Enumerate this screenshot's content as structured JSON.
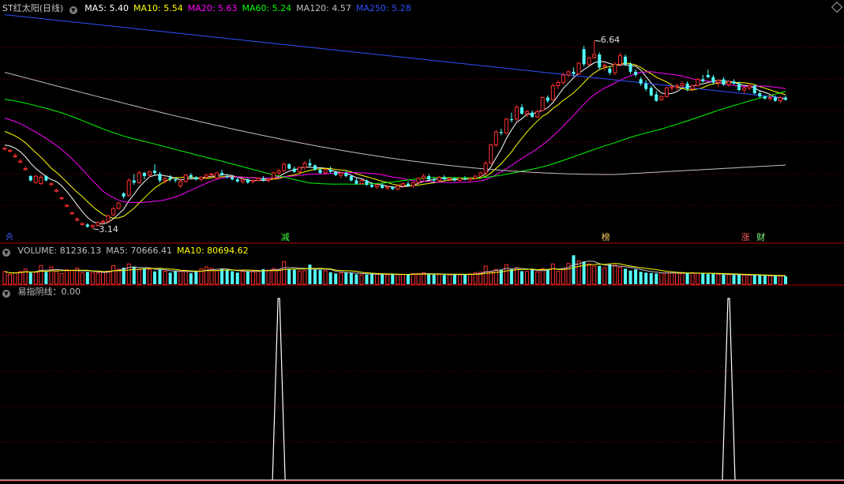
{
  "header": {
    "stock_name": "ST红太阳(日线)",
    "ma_items": [
      {
        "label": "MA5: 5.40",
        "color": "#ffffff"
      },
      {
        "label": "MA10: 5.54",
        "color": "#ffff00"
      },
      {
        "label": "MA20: 5.63",
        "color": "#ff00ff"
      },
      {
        "label": "MA60: 5.24",
        "color": "#00ff00"
      },
      {
        "label": "MA120: 4.57",
        "color": "#c0c0c0"
      },
      {
        "label": "MA250: 5.28",
        "color": "#3050ff"
      }
    ]
  },
  "volume_header": {
    "items": [
      {
        "label": "VOLUME: 81236.13",
        "color": "#c0c0c0"
      },
      {
        "label": "MA5: 70666.41",
        "color": "#c0c0c0"
      },
      {
        "label": "MA10: 80694.62",
        "color": "#ffff00"
      }
    ]
  },
  "indicator_header": {
    "label": "易指阴线：0.00"
  },
  "colors": {
    "up": "#ff3030",
    "down": "#54ffff",
    "grid": "#800000",
    "axis": "#b00000"
  },
  "chart_data": [
    {
      "type": "candlestick",
      "name": "price",
      "low_annotation": "3.14",
      "high_annotation": "6.64",
      "signal_tags": [
        {
          "index": 54,
          "text": "减",
          "color": "#40ff40"
        },
        {
          "index": 116,
          "text": "榜",
          "color": "#ffcc66"
        },
        {
          "index": 143,
          "text": "涨",
          "color": "#ff6060"
        },
        {
          "index": 146,
          "text": "财",
          "color": "#80ff80"
        }
      ],
      "ohlc": [
        [
          4.62,
          4.66,
          4.6,
          4.64
        ],
        [
          4.58,
          4.62,
          4.56,
          4.6
        ],
        [
          4.48,
          4.54,
          4.46,
          4.5
        ],
        [
          4.38,
          4.44,
          4.36,
          4.4
        ],
        [
          4.24,
          4.3,
          4.22,
          4.26
        ],
        [
          4.12,
          4.14,
          4.02,
          4.04
        ],
        [
          4.0,
          4.14,
          3.98,
          4.12
        ],
        [
          3.98,
          4.14,
          3.96,
          4.1
        ],
        [
          4.12,
          4.14,
          4.02,
          4.04
        ],
        [
          3.96,
          4.0,
          3.94,
          3.98
        ],
        [
          3.84,
          3.88,
          3.82,
          3.86
        ],
        [
          3.7,
          3.74,
          3.68,
          3.72
        ],
        [
          3.56,
          3.6,
          3.54,
          3.58
        ],
        [
          3.42,
          3.46,
          3.4,
          3.44
        ],
        [
          3.3,
          3.36,
          3.28,
          3.32
        ],
        [
          3.22,
          3.26,
          3.2,
          3.24
        ],
        [
          3.22,
          3.24,
          3.16,
          3.18
        ],
        [
          3.18,
          3.22,
          3.14,
          3.2
        ],
        [
          3.2,
          3.28,
          3.18,
          3.26
        ],
        [
          3.26,
          3.32,
          3.22,
          3.28
        ],
        [
          3.28,
          3.4,
          3.26,
          3.38
        ],
        [
          3.4,
          3.54,
          3.38,
          3.52
        ],
        [
          3.52,
          3.64,
          3.5,
          3.62
        ],
        [
          3.8,
          3.82,
          3.7,
          3.74
        ],
        [
          3.76,
          4.08,
          3.74,
          4.04
        ],
        [
          4.04,
          4.16,
          3.96,
          4.0
        ],
        [
          4.0,
          4.22,
          3.98,
          4.18
        ],
        [
          4.18,
          4.2,
          4.06,
          4.12
        ],
        [
          4.14,
          4.22,
          4.1,
          4.2
        ],
        [
          4.22,
          4.34,
          4.14,
          4.18
        ],
        [
          4.16,
          4.2,
          4.0,
          4.04
        ],
        [
          4.04,
          4.1,
          3.98,
          4.08
        ],
        [
          4.1,
          4.14,
          4.02,
          4.06
        ],
        [
          4.06,
          4.1,
          4.0,
          4.04
        ],
        [
          3.94,
          4.06,
          3.9,
          4.02
        ],
        [
          4.02,
          4.16,
          4.0,
          4.14
        ],
        [
          4.14,
          4.18,
          4.06,
          4.1
        ],
        [
          4.1,
          4.12,
          4.04,
          4.06
        ],
        [
          4.06,
          4.12,
          4.02,
          4.1
        ],
        [
          4.1,
          4.16,
          4.06,
          4.14
        ],
        [
          4.14,
          4.18,
          4.1,
          4.16
        ],
        [
          4.08,
          4.2,
          4.06,
          4.18
        ],
        [
          4.18,
          4.24,
          4.12,
          4.14
        ],
        [
          4.12,
          4.16,
          4.08,
          4.1
        ],
        [
          4.1,
          4.14,
          4.04,
          4.06
        ],
        [
          4.06,
          4.1,
          4.0,
          4.02
        ],
        [
          4.02,
          4.08,
          3.98,
          4.06
        ],
        [
          4.06,
          4.08,
          3.98,
          4.0
        ],
        [
          4.02,
          4.06,
          3.98,
          4.04
        ],
        [
          4.04,
          4.1,
          4.02,
          4.08
        ],
        [
          4.08,
          4.12,
          4.02,
          4.04
        ],
        [
          4.04,
          4.08,
          4.0,
          4.06
        ],
        [
          4.08,
          4.2,
          4.06,
          4.18
        ],
        [
          4.18,
          4.26,
          4.14,
          4.22
        ],
        [
          4.22,
          4.38,
          4.2,
          4.34
        ],
        [
          4.34,
          4.36,
          4.24,
          4.26
        ],
        [
          4.26,
          4.3,
          4.18,
          4.2
        ],
        [
          4.2,
          4.3,
          4.18,
          4.28
        ],
        [
          4.28,
          4.4,
          4.24,
          4.36
        ],
        [
          4.36,
          4.44,
          4.28,
          4.32
        ],
        [
          4.32,
          4.34,
          4.22,
          4.24
        ],
        [
          4.24,
          4.26,
          4.16,
          4.18
        ],
        [
          4.18,
          4.26,
          4.14,
          4.24
        ],
        [
          4.24,
          4.3,
          4.18,
          4.2
        ],
        [
          4.2,
          4.22,
          4.12,
          4.14
        ],
        [
          4.14,
          4.2,
          4.08,
          4.18
        ],
        [
          4.18,
          4.22,
          4.1,
          4.12
        ],
        [
          4.12,
          4.14,
          4.02,
          4.04
        ],
        [
          4.04,
          4.08,
          3.96,
          3.98
        ],
        [
          3.98,
          4.06,
          3.96,
          4.04
        ],
        [
          4.04,
          4.06,
          3.94,
          3.96
        ],
        [
          3.96,
          4.0,
          3.9,
          3.92
        ],
        [
          3.92,
          3.98,
          3.88,
          3.96
        ],
        [
          3.96,
          4.0,
          3.88,
          3.9
        ],
        [
          3.9,
          3.94,
          3.86,
          3.92
        ],
        [
          3.92,
          3.94,
          3.86,
          3.88
        ],
        [
          3.88,
          3.96,
          3.86,
          3.94
        ],
        [
          3.94,
          4.0,
          3.9,
          3.98
        ],
        [
          3.98,
          4.02,
          3.92,
          3.94
        ],
        [
          3.94,
          4.02,
          3.9,
          4.0
        ],
        [
          4.0,
          4.1,
          3.98,
          4.08
        ],
        [
          4.08,
          4.16,
          4.04,
          4.12
        ],
        [
          4.12,
          4.16,
          4.04,
          4.06
        ],
        [
          4.06,
          4.1,
          4.0,
          4.04
        ],
        [
          4.04,
          4.12,
          4.02,
          4.1
        ],
        [
          4.1,
          4.14,
          4.04,
          4.06
        ],
        [
          4.06,
          4.1,
          4.02,
          4.08
        ],
        [
          4.08,
          4.1,
          4.02,
          4.04
        ],
        [
          4.04,
          4.1,
          4.02,
          4.08
        ],
        [
          4.08,
          4.12,
          4.04,
          4.06
        ],
        [
          4.06,
          4.1,
          4.02,
          4.08
        ],
        [
          4.08,
          4.14,
          4.06,
          4.12
        ],
        [
          4.12,
          4.2,
          4.1,
          4.18
        ],
        [
          4.18,
          4.4,
          4.16,
          4.36
        ],
        [
          4.36,
          4.72,
          4.34,
          4.7
        ],
        [
          4.7,
          4.98,
          4.66,
          4.94
        ],
        [
          4.94,
          5.0,
          4.88,
          4.92
        ],
        [
          4.92,
          5.2,
          4.9,
          5.18
        ],
        [
          5.18,
          5.3,
          5.12,
          5.16
        ],
        [
          5.18,
          5.44,
          5.14,
          5.4
        ],
        [
          5.4,
          5.46,
          5.26,
          5.28
        ],
        [
          5.28,
          5.34,
          5.22,
          5.32
        ],
        [
          5.3,
          5.34,
          5.2,
          5.22
        ],
        [
          5.22,
          5.36,
          5.2,
          5.32
        ],
        [
          5.34,
          5.6,
          5.32,
          5.58
        ],
        [
          5.58,
          5.62,
          5.48,
          5.52
        ],
        [
          5.54,
          5.84,
          5.52,
          5.8
        ],
        [
          5.8,
          5.9,
          5.74,
          5.86
        ],
        [
          5.86,
          6.04,
          5.82,
          6.0
        ],
        [
          6.0,
          6.08,
          5.96,
          6.06
        ],
        [
          6.06,
          6.14,
          5.98,
          6.02
        ],
        [
          6.02,
          6.24,
          6.0,
          6.22
        ],
        [
          6.48,
          6.54,
          6.16,
          6.2
        ],
        [
          6.2,
          6.34,
          6.18,
          6.32
        ],
        [
          6.32,
          6.64,
          6.3,
          6.38
        ],
        [
          6.38,
          6.42,
          6.1,
          6.14
        ],
        [
          6.16,
          6.22,
          6.08,
          6.18
        ],
        [
          6.12,
          6.16,
          6.0,
          6.04
        ],
        [
          6.04,
          6.24,
          6.0,
          6.2
        ],
        [
          6.2,
          6.42,
          6.16,
          6.36
        ],
        [
          6.34,
          6.38,
          6.16,
          6.2
        ],
        [
          6.2,
          6.24,
          6.02,
          6.06
        ],
        [
          6.06,
          6.1,
          5.96,
          6.0
        ],
        [
          5.92,
          5.96,
          5.8,
          5.84
        ],
        [
          5.84,
          5.9,
          5.7,
          5.74
        ],
        [
          5.76,
          5.8,
          5.6,
          5.62
        ],
        [
          5.64,
          5.7,
          5.5,
          5.52
        ],
        [
          5.54,
          5.62,
          5.52,
          5.6
        ],
        [
          5.6,
          5.78,
          5.58,
          5.76
        ],
        [
          5.76,
          5.82,
          5.7,
          5.78
        ],
        [
          5.78,
          5.84,
          5.72,
          5.8
        ],
        [
          5.8,
          5.88,
          5.76,
          5.84
        ],
        [
          5.84,
          5.88,
          5.7,
          5.74
        ],
        [
          5.74,
          5.82,
          5.7,
          5.8
        ],
        [
          5.8,
          5.94,
          5.78,
          5.92
        ],
        [
          5.92,
          6.0,
          5.86,
          5.88
        ],
        [
          6.0,
          6.1,
          5.94,
          5.96
        ],
        [
          5.96,
          6.0,
          5.82,
          5.86
        ],
        [
          5.86,
          5.92,
          5.78,
          5.9
        ],
        [
          5.92,
          5.96,
          5.8,
          5.82
        ],
        [
          5.82,
          5.9,
          5.78,
          5.88
        ],
        [
          5.88,
          5.92,
          5.82,
          5.84
        ],
        [
          5.84,
          5.88,
          5.7,
          5.72
        ],
        [
          5.72,
          5.78,
          5.66,
          5.76
        ],
        [
          5.76,
          5.84,
          5.72,
          5.8
        ],
        [
          5.8,
          5.82,
          5.64,
          5.66
        ],
        [
          5.66,
          5.7,
          5.58,
          5.6
        ],
        [
          5.6,
          5.62,
          5.54,
          5.56
        ],
        [
          5.56,
          5.64,
          5.52,
          5.58
        ],
        [
          5.58,
          5.62,
          5.5,
          5.52
        ],
        [
          5.52,
          5.6,
          5.48,
          5.58
        ],
        [
          5.58,
          5.62,
          5.52,
          5.54
        ]
      ]
    },
    {
      "type": "bar",
      "name": "VOLUME",
      "values": [
        62000,
        48000,
        55000,
        61000,
        73000,
        56000,
        58000,
        90000,
        60000,
        84000,
        63000,
        52000,
        70000,
        66000,
        78000,
        55000,
        60000,
        55000,
        54000,
        61000,
        63000,
        90000,
        72000,
        80000,
        98000,
        82000,
        70000,
        76000,
        72000,
        62000,
        74000,
        63000,
        56000,
        63000,
        62000,
        67000,
        53000,
        60000,
        74000,
        84000,
        77000,
        65000,
        73000,
        70000,
        63000,
        56000,
        62000,
        61000,
        64000,
        66000,
        73000,
        68000,
        76000,
        72000,
        110000,
        74000,
        70000,
        64000,
        66000,
        95000,
        70000,
        69000,
        66000,
        58000,
        52000,
        54000,
        57000,
        56000,
        48000,
        45000,
        47000,
        52000,
        49000,
        47000,
        46000,
        48000,
        47000,
        48000,
        49000,
        51000,
        52000,
        56000,
        47000,
        46000,
        48000,
        45000,
        46000,
        47000,
        46000,
        48000,
        50000,
        56000,
        58000,
        88000,
        60000,
        72000,
        70000,
        95000,
        72000,
        80000,
        63000,
        62000,
        70000,
        60000,
        75000,
        72000,
        98000,
        62000,
        75000,
        100000,
        140000,
        112000,
        110000,
        98000,
        88000,
        89000,
        80000,
        96000,
        92000,
        82000,
        75000,
        66000,
        72000,
        60000,
        56000,
        54000,
        52000,
        55000,
        55000,
        54000,
        53000,
        52000,
        54000,
        56000,
        53000,
        52000,
        50000,
        50000,
        48000,
        47000,
        46000,
        45000,
        46000,
        45000,
        44000,
        43000,
        42000,
        41000,
        40000,
        40000,
        39000,
        38000
      ]
    },
    {
      "type": "line",
      "name": "易指阴线",
      "spikes": [
        {
          "index": 53,
          "value": 1.0
        },
        {
          "index": 140,
          "value": 1.0
        }
      ],
      "ylim": [
        0,
        1
      ]
    }
  ]
}
